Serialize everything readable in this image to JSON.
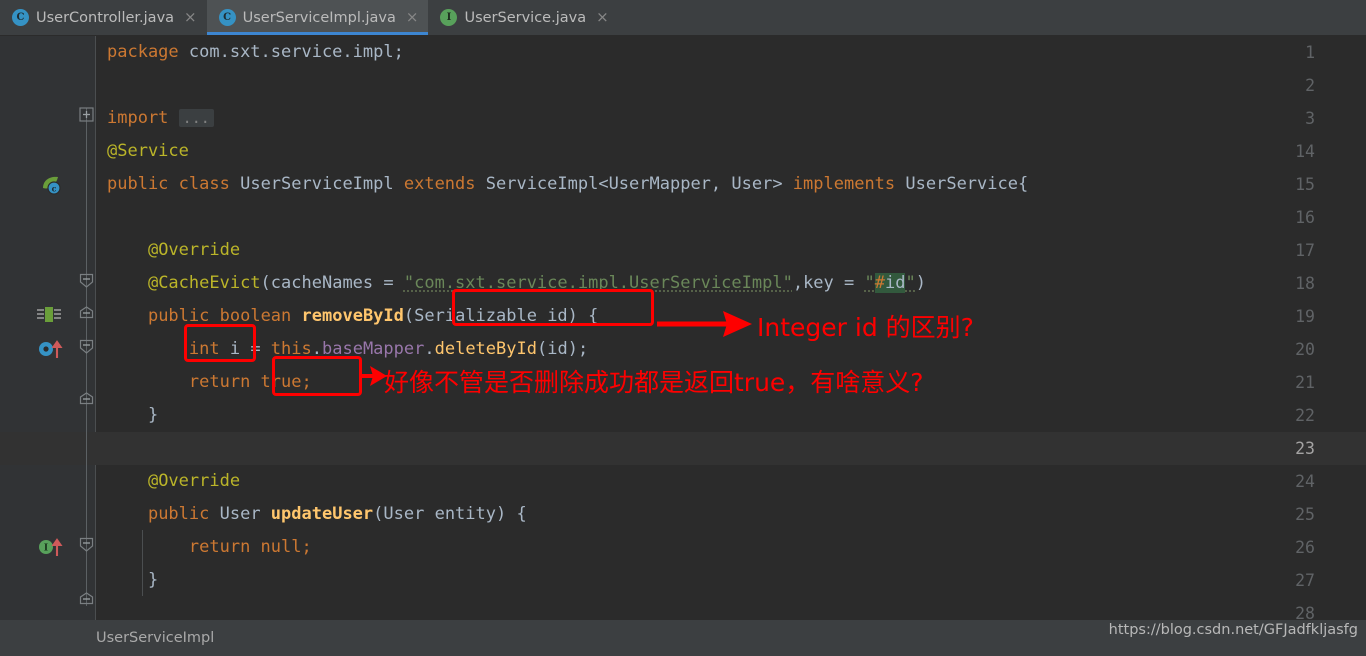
{
  "window": {
    "theme_bg": "#2b2b2b",
    "accent": "#3d86d1",
    "annotation_color": "#fe0000"
  },
  "tabs": [
    {
      "label": "UserController.java",
      "icon": "java-class-icon",
      "icon_letter": "C",
      "icon_kind": "class",
      "active": false,
      "close_label": "×"
    },
    {
      "label": "UserServiceImpl.java",
      "icon": "java-class-icon",
      "icon_letter": "C",
      "icon_kind": "class",
      "active": true,
      "close_label": "×"
    },
    {
      "label": "UserService.java",
      "icon": "java-interface-icon",
      "icon_letter": "I",
      "icon_kind": "interface",
      "active": false,
      "close_label": "×"
    }
  ],
  "editor": {
    "language": "java",
    "caret_line": "23",
    "line_numbers": [
      "1",
      "2",
      "3",
      "14",
      "15",
      "16",
      "17",
      "18",
      "19",
      "20",
      "21",
      "22",
      "23",
      "24",
      "25",
      "26",
      "27",
      "28"
    ],
    "lines": [
      {
        "n": "1",
        "text": "package com.sxt.service.impl;"
      },
      {
        "n": "2",
        "text": ""
      },
      {
        "n": "3",
        "text": "import ..."
      },
      {
        "n": "14",
        "text": "@Service"
      },
      {
        "n": "15",
        "text": "public class UserServiceImpl extends ServiceImpl<UserMapper, User> implements UserService{"
      },
      {
        "n": "16",
        "text": ""
      },
      {
        "n": "17",
        "text": "    @Override"
      },
      {
        "n": "18",
        "text": "    @CacheEvict(cacheNames = \"com.sxt.service.impl.UserServiceImpl\",key = \"#id\")"
      },
      {
        "n": "19",
        "text": "    public boolean removeById(Serializable id) {"
      },
      {
        "n": "20",
        "text": "        int i = this.baseMapper.deleteById(id);"
      },
      {
        "n": "21",
        "text": "        return true;"
      },
      {
        "n": "22",
        "text": "    }"
      },
      {
        "n": "23",
        "text": ""
      },
      {
        "n": "24",
        "text": "    @Override"
      },
      {
        "n": "25",
        "text": "    public User updateUser(User entity) {"
      },
      {
        "n": "26",
        "text": "        return null;"
      },
      {
        "n": "27",
        "text": "    }"
      },
      {
        "n": "28",
        "text": ""
      }
    ],
    "gutter_icons": [
      {
        "line": "15",
        "name": "spring-bean-icon"
      },
      {
        "line": "18",
        "name": "spring-cache-icon"
      },
      {
        "line": "19",
        "name": "overriding-method-icon"
      },
      {
        "line": "25",
        "name": "implementing-method-icon"
      }
    ],
    "fold_placeholder": "..."
  },
  "annotations": [
    {
      "name": "serializable-id-box",
      "target": "(Serializable id)"
    },
    {
      "name": "int-i-box",
      "target": "int i"
    },
    {
      "name": "return-true-box",
      "target": "true;"
    },
    {
      "name": "integer-id-note",
      "text": "Integer id  的区别?"
    },
    {
      "name": "return-true-note",
      "text": "好像不管是否删除成功都是返回true，有啥意义?"
    }
  ],
  "status": {
    "breadcrumb": "UserServiceImpl",
    "watermark": "https://blog.csdn.net/GFJadfkljasfg"
  }
}
